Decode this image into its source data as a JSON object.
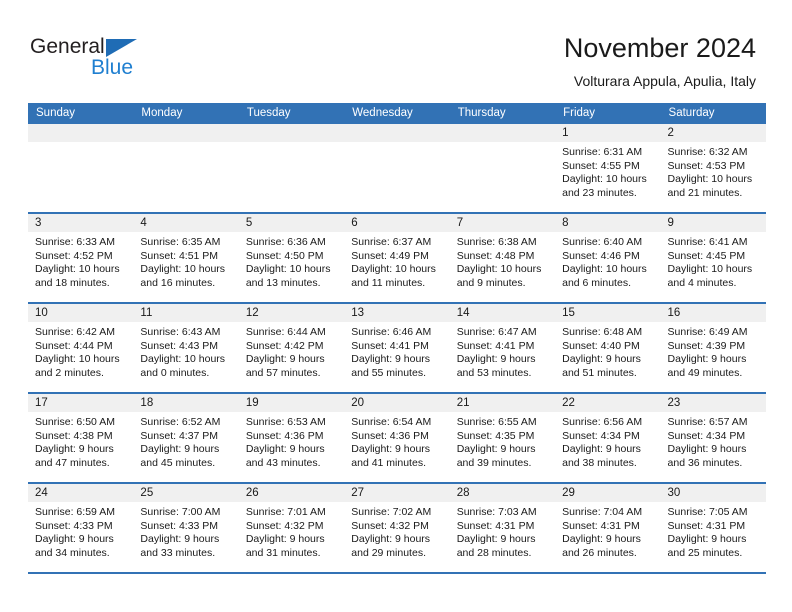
{
  "brand": {
    "name_part1": "General",
    "name_part2": "Blue",
    "triangle_color": "#1f6cb5",
    "blue_text_color": "#1f7fd0"
  },
  "header": {
    "title": "November 2024",
    "location": "Volturara Appula, Apulia, Italy"
  },
  "theme": {
    "header_blue": "#3272b5",
    "date_strip_gray": "#f0f0f0",
    "text_color": "#1a1a1a"
  },
  "weekdays": [
    "Sunday",
    "Monday",
    "Tuesday",
    "Wednesday",
    "Thursday",
    "Friday",
    "Saturday"
  ],
  "labels": {
    "sunrise_prefix": "Sunrise:",
    "sunset_prefix": "Sunset:",
    "daylight_prefix": "Daylight:"
  },
  "weeks": [
    [
      {
        "day": "",
        "empty": true
      },
      {
        "day": "",
        "empty": true
      },
      {
        "day": "",
        "empty": true
      },
      {
        "day": "",
        "empty": true
      },
      {
        "day": "",
        "empty": true
      },
      {
        "day": "1",
        "sunrise": "Sunrise: 6:31 AM",
        "sunset": "Sunset: 4:55 PM",
        "daylight1": "Daylight: 10 hours",
        "daylight2": "and 23 minutes."
      },
      {
        "day": "2",
        "sunrise": "Sunrise: 6:32 AM",
        "sunset": "Sunset: 4:53 PM",
        "daylight1": "Daylight: 10 hours",
        "daylight2": "and 21 minutes."
      }
    ],
    [
      {
        "day": "3",
        "sunrise": "Sunrise: 6:33 AM",
        "sunset": "Sunset: 4:52 PM",
        "daylight1": "Daylight: 10 hours",
        "daylight2": "and 18 minutes."
      },
      {
        "day": "4",
        "sunrise": "Sunrise: 6:35 AM",
        "sunset": "Sunset: 4:51 PM",
        "daylight1": "Daylight: 10 hours",
        "daylight2": "and 16 minutes."
      },
      {
        "day": "5",
        "sunrise": "Sunrise: 6:36 AM",
        "sunset": "Sunset: 4:50 PM",
        "daylight1": "Daylight: 10 hours",
        "daylight2": "and 13 minutes."
      },
      {
        "day": "6",
        "sunrise": "Sunrise: 6:37 AM",
        "sunset": "Sunset: 4:49 PM",
        "daylight1": "Daylight: 10 hours",
        "daylight2": "and 11 minutes."
      },
      {
        "day": "7",
        "sunrise": "Sunrise: 6:38 AM",
        "sunset": "Sunset: 4:48 PM",
        "daylight1": "Daylight: 10 hours",
        "daylight2": "and 9 minutes."
      },
      {
        "day": "8",
        "sunrise": "Sunrise: 6:40 AM",
        "sunset": "Sunset: 4:46 PM",
        "daylight1": "Daylight: 10 hours",
        "daylight2": "and 6 minutes."
      },
      {
        "day": "9",
        "sunrise": "Sunrise: 6:41 AM",
        "sunset": "Sunset: 4:45 PM",
        "daylight1": "Daylight: 10 hours",
        "daylight2": "and 4 minutes."
      }
    ],
    [
      {
        "day": "10",
        "sunrise": "Sunrise: 6:42 AM",
        "sunset": "Sunset: 4:44 PM",
        "daylight1": "Daylight: 10 hours",
        "daylight2": "and 2 minutes."
      },
      {
        "day": "11",
        "sunrise": "Sunrise: 6:43 AM",
        "sunset": "Sunset: 4:43 PM",
        "daylight1": "Daylight: 10 hours",
        "daylight2": "and 0 minutes."
      },
      {
        "day": "12",
        "sunrise": "Sunrise: 6:44 AM",
        "sunset": "Sunset: 4:42 PM",
        "daylight1": "Daylight: 9 hours",
        "daylight2": "and 57 minutes."
      },
      {
        "day": "13",
        "sunrise": "Sunrise: 6:46 AM",
        "sunset": "Sunset: 4:41 PM",
        "daylight1": "Daylight: 9 hours",
        "daylight2": "and 55 minutes."
      },
      {
        "day": "14",
        "sunrise": "Sunrise: 6:47 AM",
        "sunset": "Sunset: 4:41 PM",
        "daylight1": "Daylight: 9 hours",
        "daylight2": "and 53 minutes."
      },
      {
        "day": "15",
        "sunrise": "Sunrise: 6:48 AM",
        "sunset": "Sunset: 4:40 PM",
        "daylight1": "Daylight: 9 hours",
        "daylight2": "and 51 minutes."
      },
      {
        "day": "16",
        "sunrise": "Sunrise: 6:49 AM",
        "sunset": "Sunset: 4:39 PM",
        "daylight1": "Daylight: 9 hours",
        "daylight2": "and 49 minutes."
      }
    ],
    [
      {
        "day": "17",
        "sunrise": "Sunrise: 6:50 AM",
        "sunset": "Sunset: 4:38 PM",
        "daylight1": "Daylight: 9 hours",
        "daylight2": "and 47 minutes."
      },
      {
        "day": "18",
        "sunrise": "Sunrise: 6:52 AM",
        "sunset": "Sunset: 4:37 PM",
        "daylight1": "Daylight: 9 hours",
        "daylight2": "and 45 minutes."
      },
      {
        "day": "19",
        "sunrise": "Sunrise: 6:53 AM",
        "sunset": "Sunset: 4:36 PM",
        "daylight1": "Daylight: 9 hours",
        "daylight2": "and 43 minutes."
      },
      {
        "day": "20",
        "sunrise": "Sunrise: 6:54 AM",
        "sunset": "Sunset: 4:36 PM",
        "daylight1": "Daylight: 9 hours",
        "daylight2": "and 41 minutes."
      },
      {
        "day": "21",
        "sunrise": "Sunrise: 6:55 AM",
        "sunset": "Sunset: 4:35 PM",
        "daylight1": "Daylight: 9 hours",
        "daylight2": "and 39 minutes."
      },
      {
        "day": "22",
        "sunrise": "Sunrise: 6:56 AM",
        "sunset": "Sunset: 4:34 PM",
        "daylight1": "Daylight: 9 hours",
        "daylight2": "and 38 minutes."
      },
      {
        "day": "23",
        "sunrise": "Sunrise: 6:57 AM",
        "sunset": "Sunset: 4:34 PM",
        "daylight1": "Daylight: 9 hours",
        "daylight2": "and 36 minutes."
      }
    ],
    [
      {
        "day": "24",
        "sunrise": "Sunrise: 6:59 AM",
        "sunset": "Sunset: 4:33 PM",
        "daylight1": "Daylight: 9 hours",
        "daylight2": "and 34 minutes."
      },
      {
        "day": "25",
        "sunrise": "Sunrise: 7:00 AM",
        "sunset": "Sunset: 4:33 PM",
        "daylight1": "Daylight: 9 hours",
        "daylight2": "and 33 minutes."
      },
      {
        "day": "26",
        "sunrise": "Sunrise: 7:01 AM",
        "sunset": "Sunset: 4:32 PM",
        "daylight1": "Daylight: 9 hours",
        "daylight2": "and 31 minutes."
      },
      {
        "day": "27",
        "sunrise": "Sunrise: 7:02 AM",
        "sunset": "Sunset: 4:32 PM",
        "daylight1": "Daylight: 9 hours",
        "daylight2": "and 29 minutes."
      },
      {
        "day": "28",
        "sunrise": "Sunrise: 7:03 AM",
        "sunset": "Sunset: 4:31 PM",
        "daylight1": "Daylight: 9 hours",
        "daylight2": "and 28 minutes."
      },
      {
        "day": "29",
        "sunrise": "Sunrise: 7:04 AM",
        "sunset": "Sunset: 4:31 PM",
        "daylight1": "Daylight: 9 hours",
        "daylight2": "and 26 minutes."
      },
      {
        "day": "30",
        "sunrise": "Sunrise: 7:05 AM",
        "sunset": "Sunset: 4:31 PM",
        "daylight1": "Daylight: 9 hours",
        "daylight2": "and 25 minutes."
      }
    ]
  ]
}
